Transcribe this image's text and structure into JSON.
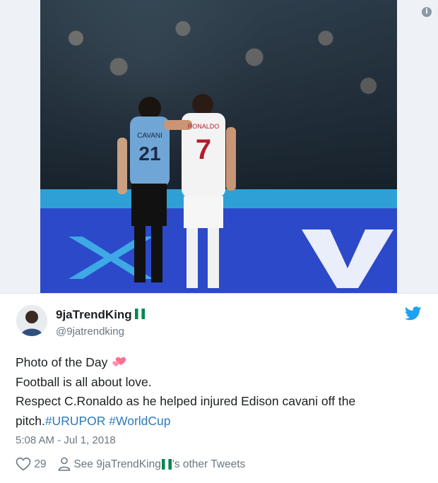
{
  "tweet": {
    "display_name": "9jaTrendKing",
    "handle": "@9jatrendking",
    "text_line1": "Photo of the Day",
    "text_line2": "Football is all about love.",
    "text_line3": "Respect C.Ronaldo as he helped injured Edison cavani off the",
    "text_line4_plain": "pitch.",
    "hashtag1": "#URUPOR",
    "hashtag2": "#WorldCup",
    "timestamp": "5:08 AM - Jul 1, 2018",
    "like_count": "29",
    "other_tweets_prefix": "See 9jaTrendKing",
    "other_tweets_suffix": "'s other Tweets"
  },
  "photo": {
    "jersey_left_name": "CAVANI",
    "jersey_left_number": "21",
    "jersey_right_name": "RONALDO",
    "jersey_right_number": "7"
  },
  "icons": {
    "info": "info-icon",
    "twitter": "twitter-bird-icon",
    "like": "heart-outline-icon",
    "profile": "person-outline-icon",
    "flag": "nigeria-flag-icon",
    "emoji": "two-hearts-emoji-icon"
  },
  "colors": {
    "link": "#2b7bb9",
    "twitter_blue": "#1da1f2",
    "text_primary": "#1c2022",
    "text_secondary": "#697882",
    "flag_green": "#008751"
  }
}
